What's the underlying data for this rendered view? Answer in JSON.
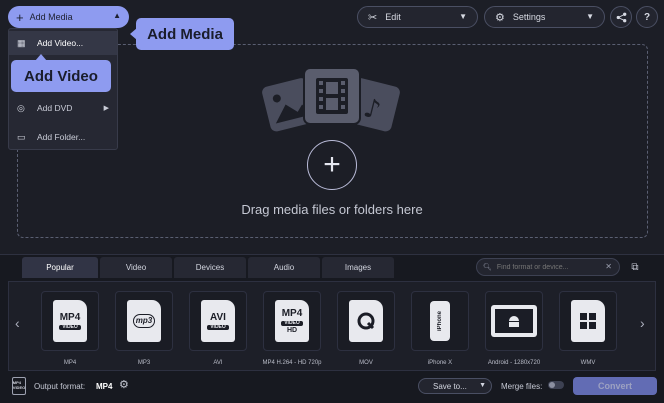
{
  "toolbar": {
    "add_media_label": "Add Media",
    "edit_label": "Edit",
    "settings_label": "Settings"
  },
  "add_media_menu": {
    "items": [
      {
        "label": "Add Video...",
        "icon": "film-icon"
      },
      {
        "label": "Add DVD",
        "icon": "disc-icon"
      },
      {
        "label": "Add Folder...",
        "icon": "folder-plus-icon"
      }
    ]
  },
  "tooltips": {
    "add_media": "Add Media",
    "add_video": "Add Video"
  },
  "dropzone": {
    "text": "Drag media files or folders here"
  },
  "format_tabs": [
    "Popular",
    "Video",
    "Devices",
    "Audio",
    "Images"
  ],
  "format_search": {
    "placeholder": "Find format or device..."
  },
  "formats": [
    {
      "label": "MP4"
    },
    {
      "label": "MP3"
    },
    {
      "label": "AVI"
    },
    {
      "label": "MP4 H.264 - HD 720p"
    },
    {
      "label": "MOV"
    },
    {
      "label": "iPhone X"
    },
    {
      "label": "Android - 1280x720"
    },
    {
      "label": "WMV"
    }
  ],
  "format_icon_text": {
    "mp4": "MP4",
    "mp4_sub": "VIDEO",
    "mp3": "mp3",
    "avi": "AVI",
    "avi_sub": "VIDEO",
    "mp4hd": "MP4",
    "mp4hd_sub": "VIDEO",
    "mp4hd_hd": "HD",
    "iphone": "iPhone"
  },
  "status_bar": {
    "output_icon_text": "MP4 VIDEO",
    "output_format_label": "Output format:",
    "output_format_value": "MP4",
    "save_to_label": "Save to...",
    "merge_files_label": "Merge files:",
    "convert_label": "Convert"
  },
  "colors": {
    "accent": "#8e9bf0",
    "background": "#1c1e26"
  }
}
